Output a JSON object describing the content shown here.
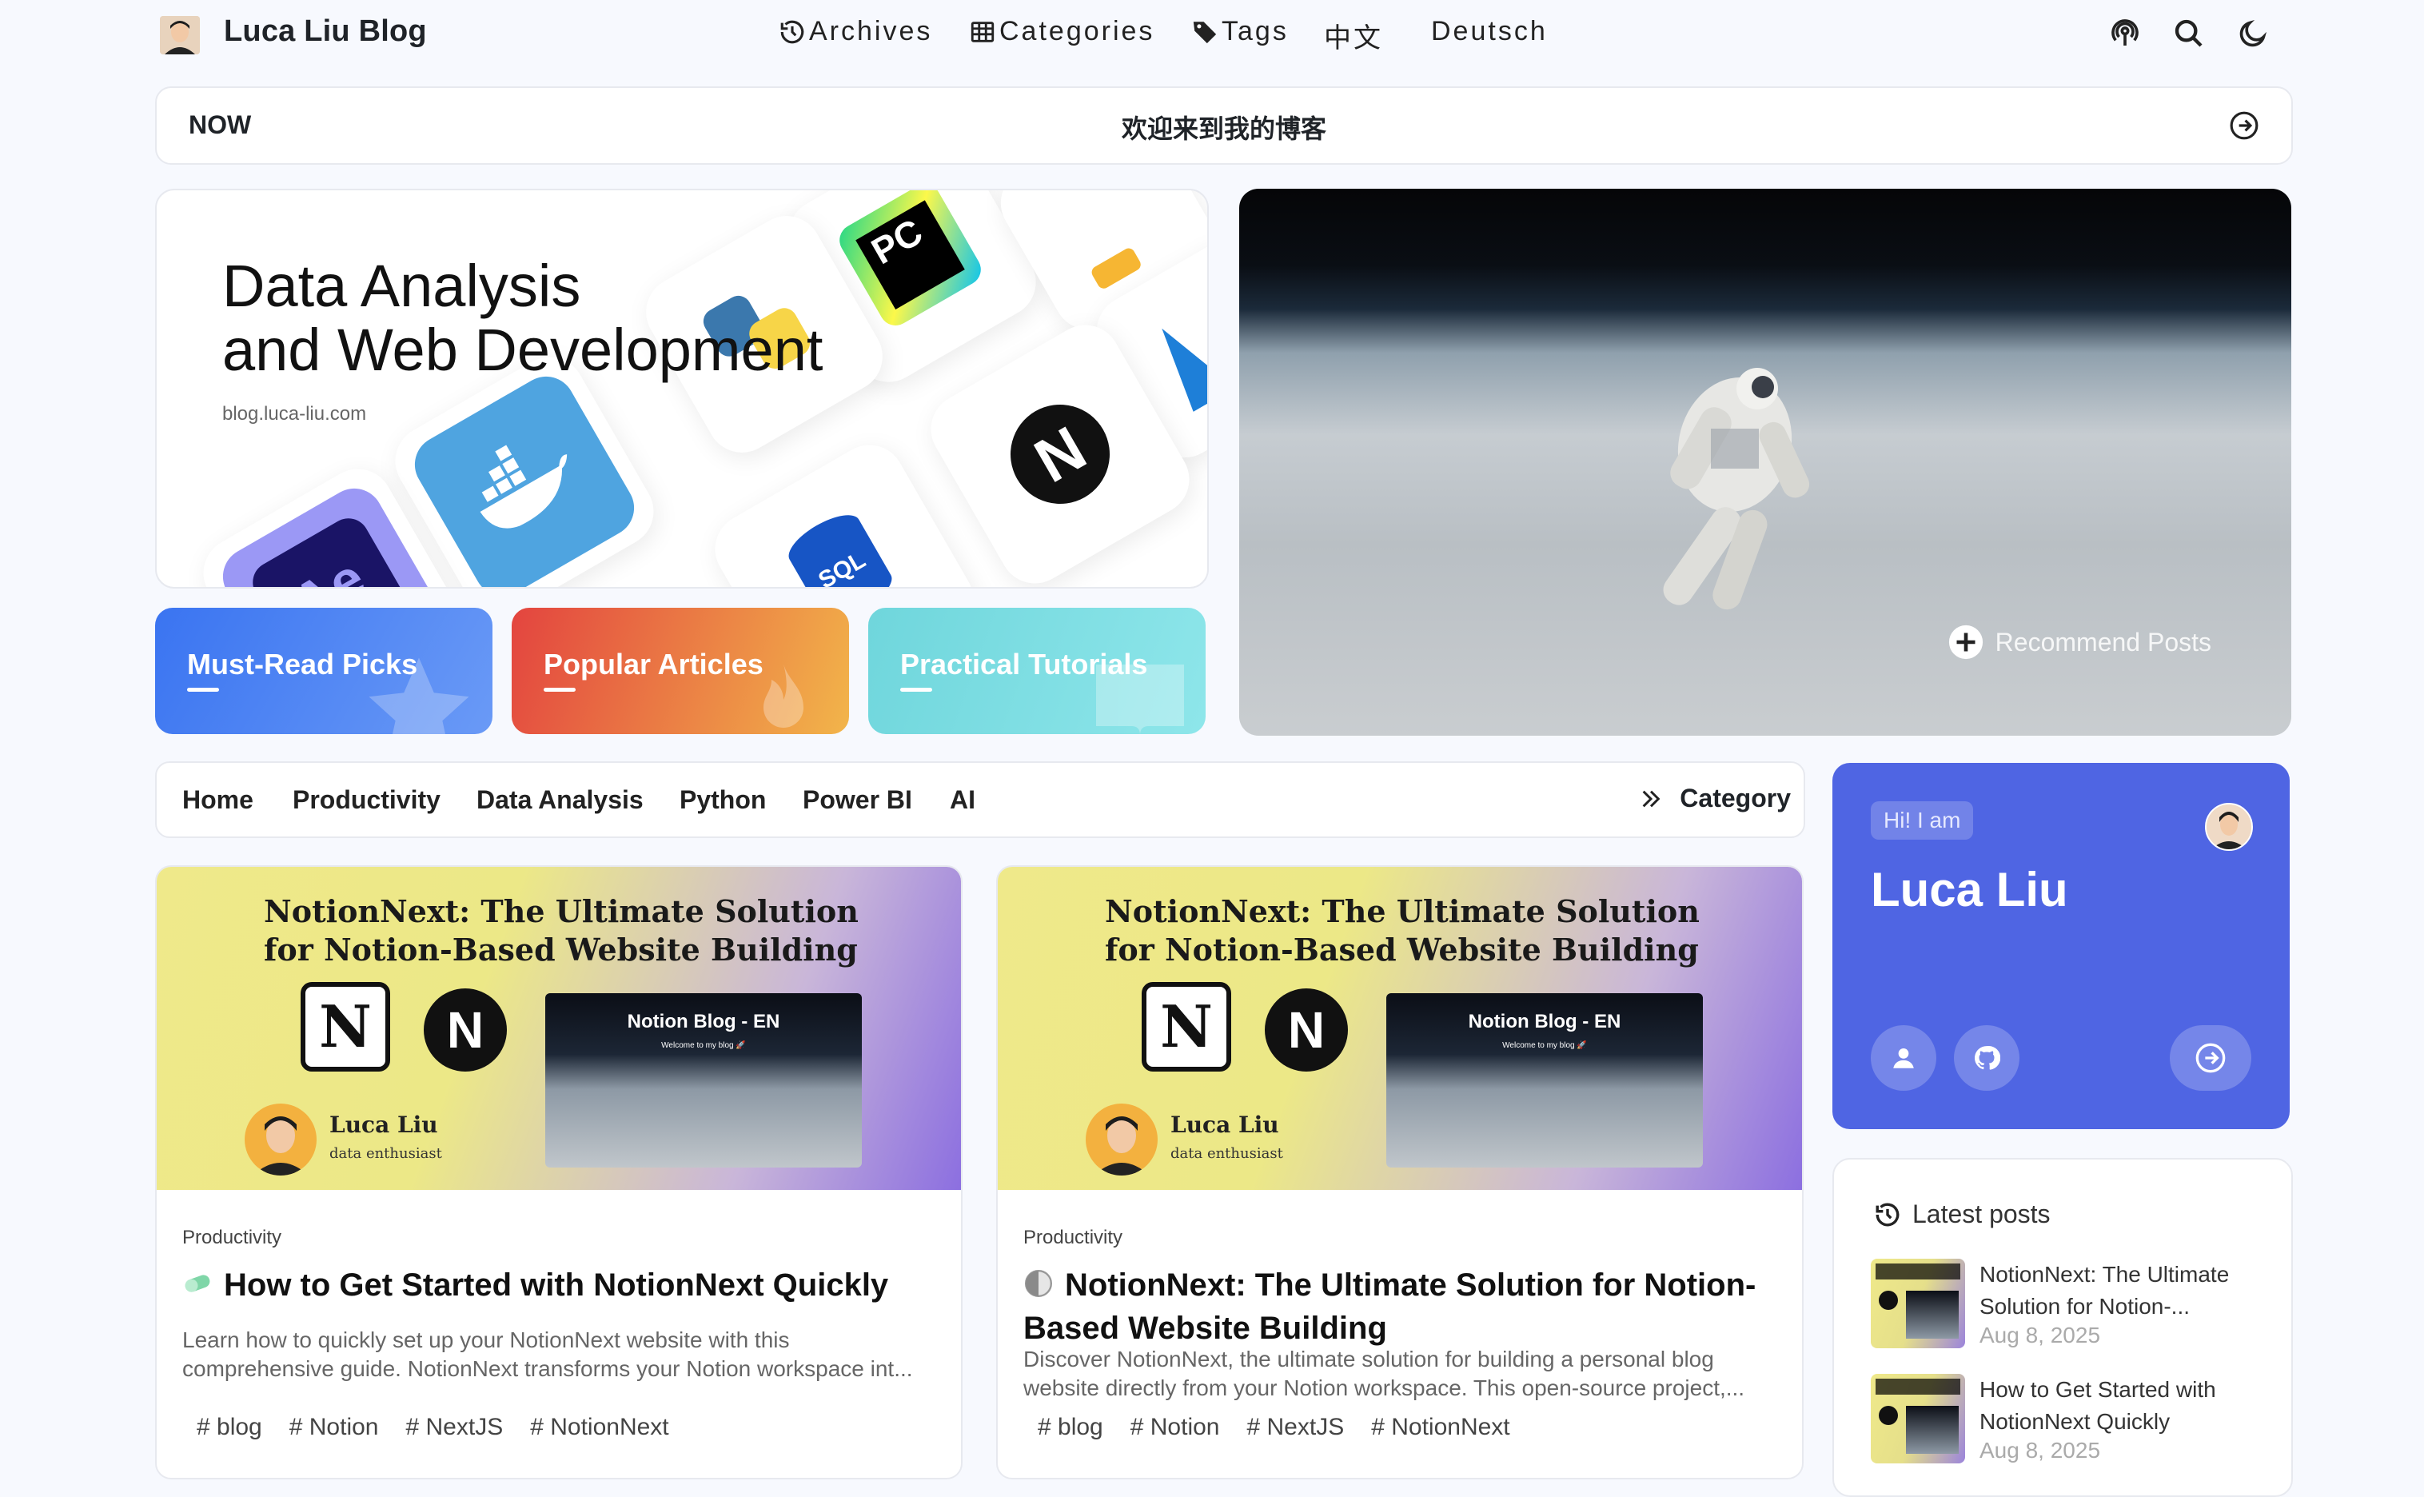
{
  "header": {
    "site_title": "Luca Liu Blog",
    "nav": [
      {
        "label": "Archives",
        "icon": "history-icon"
      },
      {
        "label": "Categories",
        "icon": "grid-icon"
      },
      {
        "label": "Tags",
        "icon": "tag-icon"
      },
      {
        "label": "中文",
        "icon": ""
      },
      {
        "label": "Deutsch",
        "icon": ""
      }
    ],
    "icons": [
      "podcast-icon",
      "search-icon",
      "moon-icon"
    ]
  },
  "notice": {
    "label": "NOW",
    "text": "欢迎来到我的博客"
  },
  "hero": {
    "title_line1": "Data Analysis",
    "title_line2": "and Web Development",
    "subtitle": "blog.luca-liu.com",
    "tile_labels": {
      "pycharm": "PC",
      "sql": "SQL",
      "after_effects": "Ae",
      "next": "N"
    }
  },
  "category_tiles": [
    {
      "label": "Must-Read Picks",
      "color_from": "#3a74f1",
      "color_to": "#6a9af6"
    },
    {
      "label": "Popular Articles",
      "color_from": "#e3443f",
      "color_to": "#f2b54a"
    },
    {
      "label": "Practical Tutorials",
      "color_from": "#6fd6dc",
      "color_to": "#8ee6ea"
    }
  ],
  "feature": {
    "recommend_label": "Recommend Posts"
  },
  "category_bar": {
    "links": [
      "Home",
      "Productivity",
      "Data Analysis",
      "Python",
      "Power BI",
      "AI"
    ],
    "more_label": "Category"
  },
  "posts": [
    {
      "cover_title": "NotionNext: The Ultimate Solution for Notion-Based Website Building",
      "cover_author": "Luca Liu",
      "cover_role": "data enthusiast",
      "cover_shot_title": "Notion Blog - EN",
      "cover_shot_sub": "Welcome to my blog 🚀",
      "category": "Productivity",
      "title": "How to Get Started with NotionNext Quickly",
      "description": "Learn how to quickly set up your NotionNext website with this comprehensive guide. NotionNext transforms your Notion workspace int...",
      "tags": [
        "# blog",
        "# Notion",
        "# NextJS",
        "# NotionNext"
      ]
    },
    {
      "cover_title": "NotionNext: The Ultimate Solution for Notion-Based Website Building",
      "cover_author": "Luca Liu",
      "cover_role": "data enthusiast",
      "cover_shot_title": "Notion Blog - EN",
      "cover_shot_sub": "Welcome to my blog 🚀",
      "category": "Productivity",
      "title": "NotionNext: The Ultimate Solution for Notion-Based Website Building",
      "description": "Discover NotionNext, the ultimate solution for building a personal blog website directly from your Notion workspace. This open-source project,...",
      "tags": [
        "# blog",
        "# Notion",
        "# NextJS",
        "# NotionNext"
      ]
    }
  ],
  "profile": {
    "greeting": "Hi! I am",
    "name": "Luca Liu"
  },
  "latest": {
    "heading": "Latest posts",
    "items": [
      {
        "title": "NotionNext: The Ultimate Solution for Notion-...",
        "date": "Aug 8, 2025"
      },
      {
        "title": "How to Get Started with NotionNext Quickly",
        "date": "Aug 8, 2025"
      }
    ]
  },
  "colors": {
    "accent": "#4f65e3",
    "background": "#f7f9fe"
  }
}
